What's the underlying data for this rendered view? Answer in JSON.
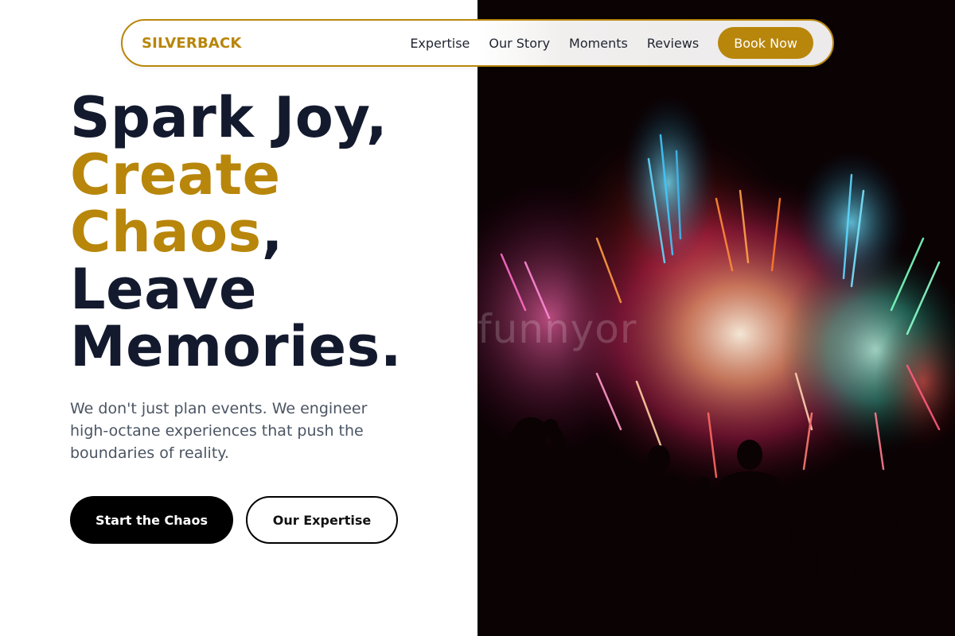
{
  "nav": {
    "brand": "SILVERBACK",
    "links": [
      "Expertise",
      "Our Story",
      "Moments",
      "Reviews"
    ],
    "cta": "Book Now"
  },
  "hero": {
    "headline": {
      "line1": "Spark Joy,",
      "line2": "Create",
      "line3_gold": "Chaos",
      "line3_tail": ",",
      "line4": "Leave",
      "line5": "Memories."
    },
    "subtext": "We don't just plan events. We engineer high-octane experiences that push the boundaries of reality.",
    "primary_cta": "Start the Chaos",
    "secondary_cta": "Our Expertise"
  },
  "image": {
    "subject": "fireworks-crowd-silhouette",
    "watermark": "funnyor"
  },
  "colors": {
    "accent": "#b8860b",
    "heading": "#141a2e",
    "body_text": "#4b5563"
  }
}
